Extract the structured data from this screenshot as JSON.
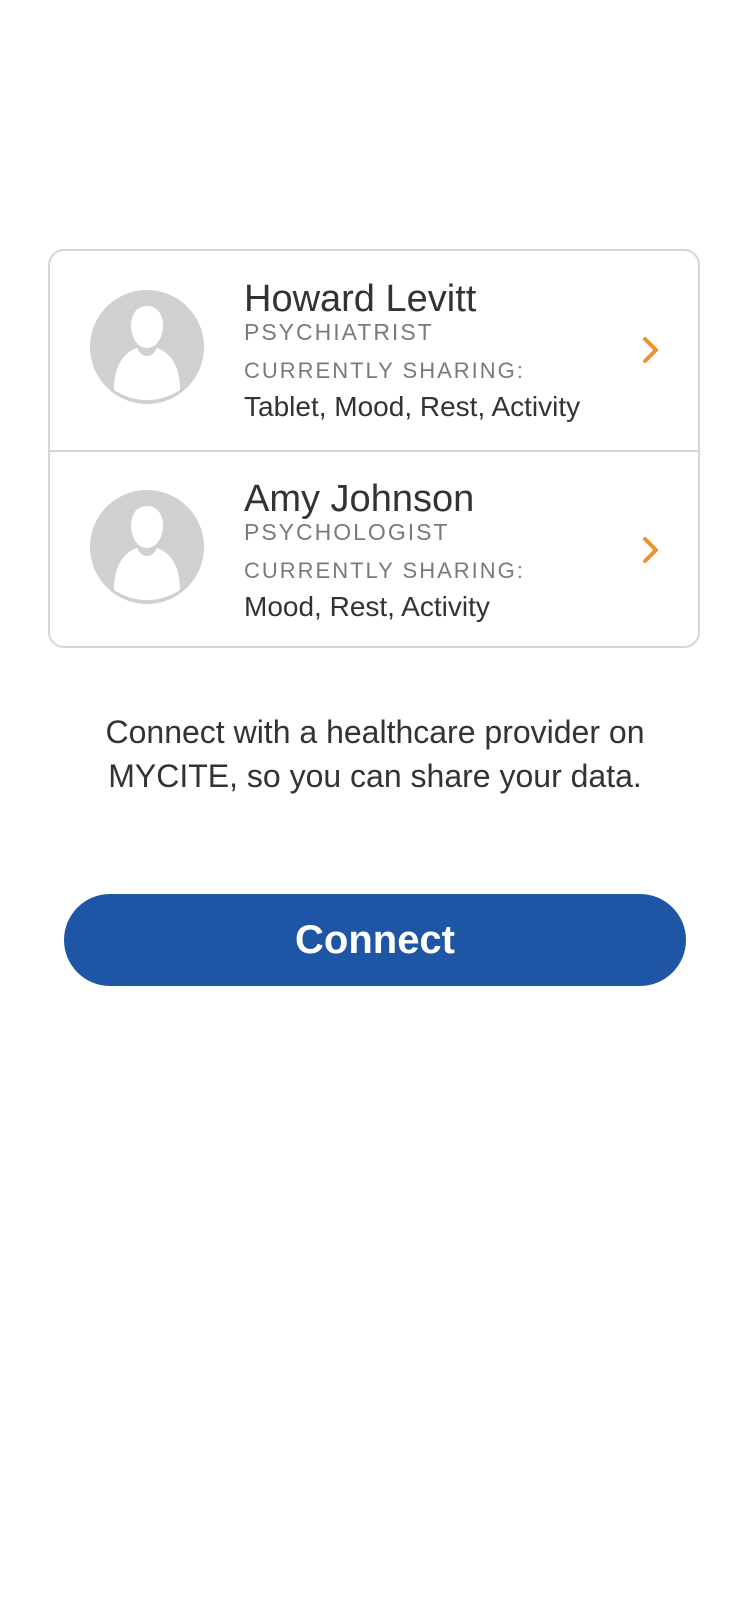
{
  "providers": [
    {
      "name": "Howard Levitt",
      "role": "PSYCHIATRIST",
      "sharing_label": "CURRENTLY SHARING:",
      "sharing_value": "Tablet, Mood, Rest, Activity"
    },
    {
      "name": "Amy Johnson",
      "role": "PSYCHOLOGIST",
      "sharing_label": "CURRENTLY SHARING:",
      "sharing_value": "Mood, Rest, Activity"
    }
  ],
  "message": "Connect with a healthcare provider on MYCITE, so you can share your data.",
  "connect_button": {
    "label": "Connect"
  },
  "icons": {
    "avatar": "person-avatar-icon",
    "chevron": "chevron-right-icon"
  },
  "colors": {
    "primary": "#1e56a5",
    "chevron": "#f0922b",
    "avatar_bg": "#d0d0d0",
    "border": "#d6d6d6",
    "text": "#333333",
    "muted": "#7a7a7a"
  }
}
